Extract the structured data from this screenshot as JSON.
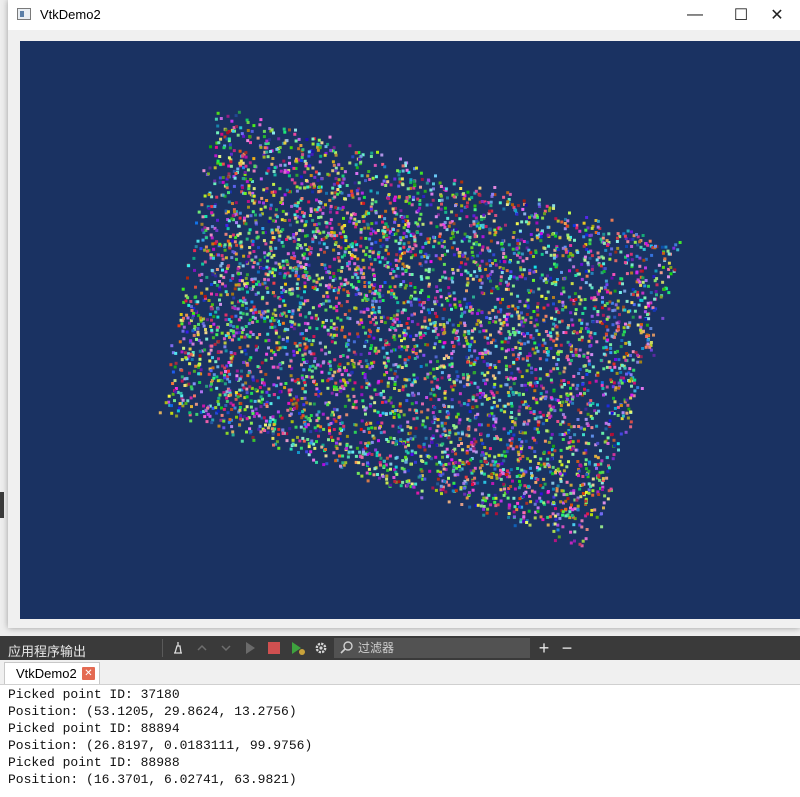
{
  "window": {
    "title": "VtkDemo2",
    "icon": "app-window-icon",
    "controls": {
      "minimize": "—",
      "maximize": "☐",
      "close": "✕"
    }
  },
  "render_view": {
    "background_color": "#1a3262",
    "content": "point-cloud-cube"
  },
  "output_panel": {
    "title": "应用程序输出",
    "toolbar_icons": [
      "clear-icon",
      "up-arrow-icon",
      "down-arrow-icon",
      "run-icon",
      "stop-icon",
      "run-debug-icon",
      "gear-icon"
    ],
    "filter_placeholder": "过滤器",
    "add_label": "+",
    "remove_label": "−",
    "tab_label": "VtkDemo2",
    "tab_close": "✕",
    "lines": [
      "Picked point ID: 37180",
      "Position: (53.1205, 29.8624, 13.2756)",
      "Picked point ID: 88894",
      "Position: (26.8197, 0.0183111, 99.9756)",
      "Picked point ID: 88988",
      "Position: (16.3701, 6.02741, 63.9821)"
    ]
  }
}
